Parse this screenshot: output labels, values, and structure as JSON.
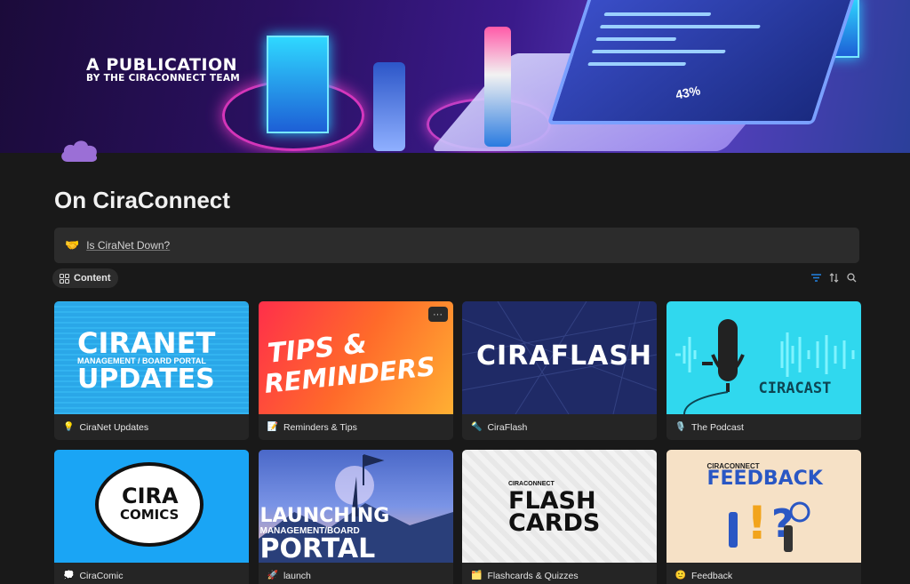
{
  "banner": {
    "title": "A PUBLICATION",
    "subtitle": "BY THE CIRACONNECT TEAM",
    "percent": "43%"
  },
  "page": {
    "title": "On CiraConnect"
  },
  "callout": {
    "emoji": "🤝",
    "link_text": "Is CiraNet Down?"
  },
  "view": {
    "tab_label": "Content"
  },
  "cards": [
    {
      "emoji": "💡",
      "label": "CiraNet Updates",
      "cover_text": [
        "CIRANET",
        "MANAGEMENT / BOARD PORTAL",
        "UPDATES"
      ]
    },
    {
      "emoji": "📝",
      "label": "Reminders & Tips",
      "cover_text": [
        "TIPS &",
        "REMINDERS"
      ],
      "more": "···"
    },
    {
      "emoji": "🔦",
      "label": "CiraFlash",
      "cover_text": [
        "CIRAFLASH"
      ]
    },
    {
      "emoji": "🎙️",
      "label": "The Podcast",
      "cover_text": [
        "CIRACAST"
      ]
    },
    {
      "emoji": "💭",
      "label": "CiraComic",
      "cover_text": [
        "CIRA",
        "COMICS"
      ]
    },
    {
      "emoji": "🚀",
      "label": "launch",
      "cover_text": [
        "LAUNCHING",
        "MANAGEMENT/BOARD",
        "PORTAL"
      ]
    },
    {
      "emoji": "🗂️",
      "label": "Flashcards & Quizzes",
      "cover_text": [
        "CIRACONNECT",
        "FLASH",
        "CARDS"
      ]
    },
    {
      "emoji": "🙂",
      "label": "Feedback",
      "cover_text": [
        "CIRACONNECT",
        "FEEDBACK"
      ]
    }
  ],
  "icons": {
    "page_icon": "cloud-icon",
    "filter": "filter-icon",
    "sort": "sort-icon",
    "search": "search-icon"
  },
  "colors": {
    "background": "#191919",
    "accent": "#2383e2",
    "page_icon": "#9b6fd6"
  }
}
